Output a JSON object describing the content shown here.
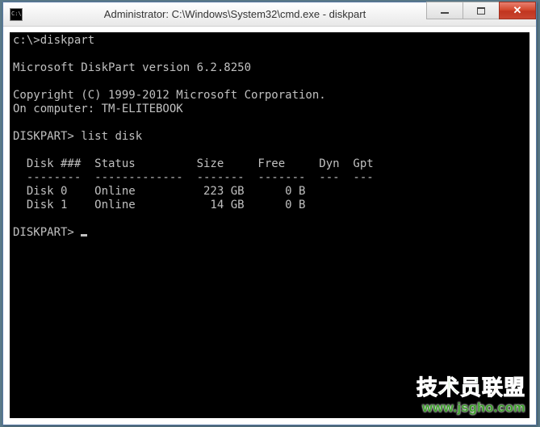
{
  "titlebar": {
    "text": "Administrator: C:\\Windows\\System32\\cmd.exe - diskpart"
  },
  "console": {
    "prompt1": "c:\\>",
    "cmd1": "diskpart",
    "blank": "",
    "version": "Microsoft DiskPart version 6.2.8250",
    "copyright": "Copyright (C) 1999-2012 Microsoft Corporation.",
    "computer": "On computer: TM-ELITEBOOK",
    "prompt2": "DISKPART> ",
    "cmd2": "list disk",
    "header": "  Disk ###  Status         Size     Free     Dyn  Gpt",
    "divider": "  --------  -------------  -------  -------  ---  ---",
    "row0": "  Disk 0    Online          223 GB      0 B",
    "row1": "  Disk 1    Online           14 GB      0 B",
    "prompt3": "DISKPART> "
  },
  "watermark": {
    "brand_g": "技术员",
    "brand_o": "联盟",
    "url": "www.jsgho.com"
  }
}
